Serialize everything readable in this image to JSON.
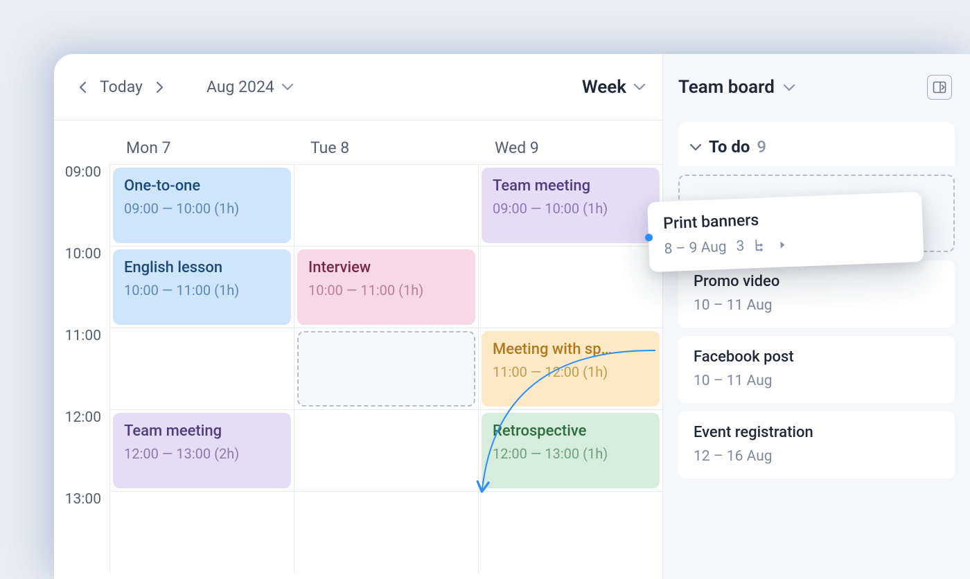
{
  "toolbar": {
    "today": "Today",
    "month": "Aug 2024",
    "view": "Week"
  },
  "days": [
    "Mon 7",
    "Tue 8",
    "Wed 9"
  ],
  "times": [
    "09:00",
    "10:00",
    "11:00",
    "12:00",
    "13:00"
  ],
  "events": {
    "mon9": {
      "title": "One-to-one",
      "time": "09:00 — 10:00 (1h)"
    },
    "mon10": {
      "title": "English lesson",
      "time": "10:00 — 11:00 (1h)"
    },
    "mon12": {
      "title": "Team meeting",
      "time": "12:00 — 13:00 (2h)"
    },
    "tue10": {
      "title": "Interview",
      "time": "10:00 — 11:00 (1h)"
    },
    "wed9": {
      "title": "Team meeting",
      "time": "09:00 — 10:00 (1h)"
    },
    "wed11": {
      "title": "Meeting with sp…",
      "time": "11:00 — 12:00 (1h)"
    },
    "wed12": {
      "title": "Retrospective",
      "time": "12:00 — 13:00 (1h)"
    }
  },
  "board": {
    "title": "Team board",
    "section": {
      "name": "To do",
      "count": "9"
    },
    "drag": {
      "title": "Print banners",
      "date": "8 – 9 Aug",
      "count": "3"
    },
    "tasks": [
      {
        "title": "Promo video",
        "date": "10 – 11 Aug"
      },
      {
        "title": "Facebook post",
        "date": "10 – 11 Aug"
      },
      {
        "title": "Event registration",
        "date": "12 – 16 Aug"
      }
    ]
  }
}
